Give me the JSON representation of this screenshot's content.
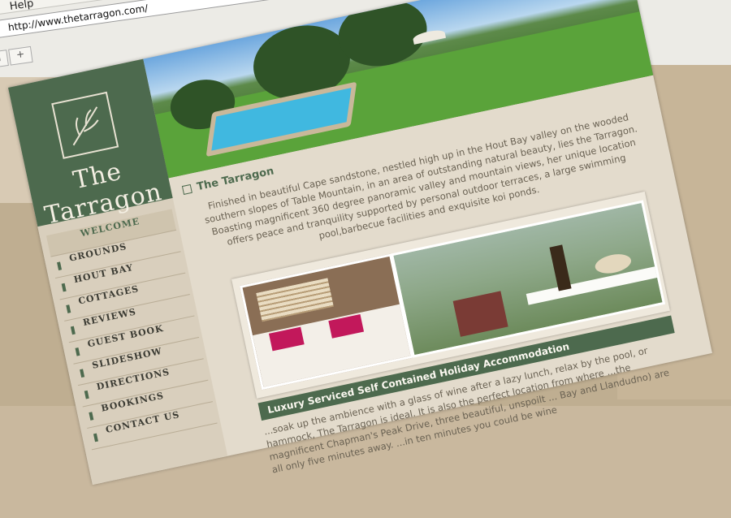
{
  "browser": {
    "menu_help": "Help",
    "address": "http://www.thetarragon.com/"
  },
  "site": {
    "logo_text": "The Tarragon",
    "nav": [
      "WELCOME",
      "GROUNDS",
      "HOUT BAY",
      "COTTAGES",
      "REVIEWS",
      "GUEST BOOK",
      "SLIDESHOW",
      "DIRECTIONS",
      "BOOKINGS",
      "CONTACT US"
    ],
    "section_title": "The Tarragon",
    "intro": "Finished in beautiful Cape sandstone, nestled high up in the Hout Bay valley on the wooded southern slopes of Table Mountain, in an area of outstanding natural beauty, lies the Tarragon. Boasting magnificent 360 degree panoramic valley and mountain views, her unique location offers peace and tranquility supported by personal outdoor terraces, a large swimming pool,barbecue facilities and exquisite koi ponds.",
    "banner": "Luxury Serviced Self Contained Holiday Accommodation",
    "body": "...soak up the ambience with a glass of wine after a lazy lunch, relax by the pool, or hammock, The Tarragon is ideal. It is also the perfect location from where ...the magnificent Chapman's Peak Drive, three beautiful, unspoilt ... Bay and Llandudno) are all only five minutes away. ...in ten minutes you could be wine",
    "brand_color": "#4d6a4e"
  }
}
